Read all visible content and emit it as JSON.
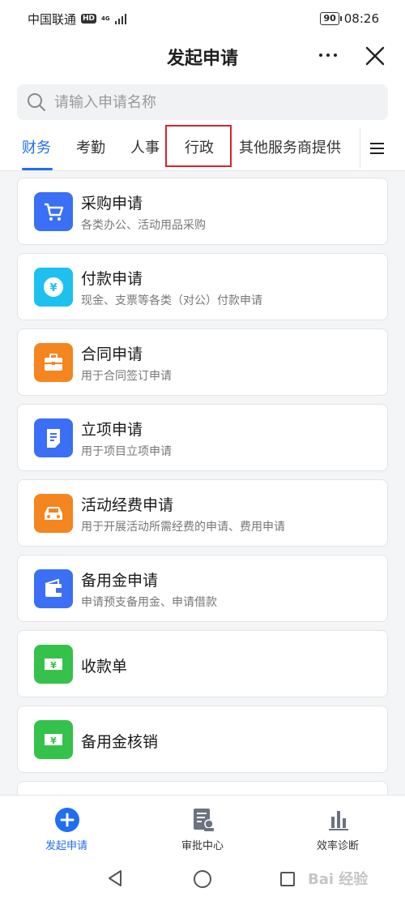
{
  "status": {
    "carrier": "中国联通",
    "hd": "HD",
    "network": "4G",
    "battery": "90",
    "time": "08:26"
  },
  "nav": {
    "title": "发起申请",
    "more_icon": "more-icon",
    "close_icon": "close-icon"
  },
  "search": {
    "placeholder": "请输入申请名称",
    "icon": "search-icon"
  },
  "tabs": [
    {
      "label": "财务",
      "active": true
    },
    {
      "label": "考勤",
      "active": false
    },
    {
      "label": "人事",
      "active": false
    },
    {
      "label": "行政",
      "active": false,
      "highlighted": true
    },
    {
      "label": "其他服务商提供",
      "active": false
    }
  ],
  "items": [
    {
      "title": "采购申请",
      "desc": "各类办公、活动用品采购",
      "icon": "cart-icon",
      "color": "#3b6ff5"
    },
    {
      "title": "付款申请",
      "desc": "现金、支票等各类（对公）付款申请",
      "icon": "yen-coin-icon",
      "color": "#1ec0f0"
    },
    {
      "title": "合同申请",
      "desc": "用于合同签订申请",
      "icon": "briefcase-icon",
      "color": "#f5851f"
    },
    {
      "title": "立项申请",
      "desc": "用于项目立项申请",
      "icon": "document-icon",
      "color": "#3b6ff5"
    },
    {
      "title": "活动经费申请",
      "desc": "用于开展活动所需经费的申请、费用申请",
      "icon": "car-icon",
      "color": "#f5851f"
    },
    {
      "title": "备用金申请",
      "desc": "申请预支备用金、申请借款",
      "icon": "wallet-icon",
      "color": "#3b6ff5"
    },
    {
      "title": "收款单",
      "desc": "",
      "icon": "yen-bill-icon",
      "color": "#35c24a"
    },
    {
      "title": "备用金核销",
      "desc": "",
      "icon": "yen-bill-icon",
      "color": "#35c24a"
    }
  ],
  "bottom_nav": [
    {
      "label": "发起申请",
      "icon": "plus-circle-icon",
      "active": true
    },
    {
      "label": "审批中心",
      "icon": "approval-stamp-icon",
      "active": false
    },
    {
      "label": "效率诊断",
      "icon": "bar-chart-icon",
      "active": false
    }
  ],
  "colors": {
    "accent": "#1f6ff0",
    "highlight_border": "#d9232d"
  },
  "watermark": "Bai 经验"
}
